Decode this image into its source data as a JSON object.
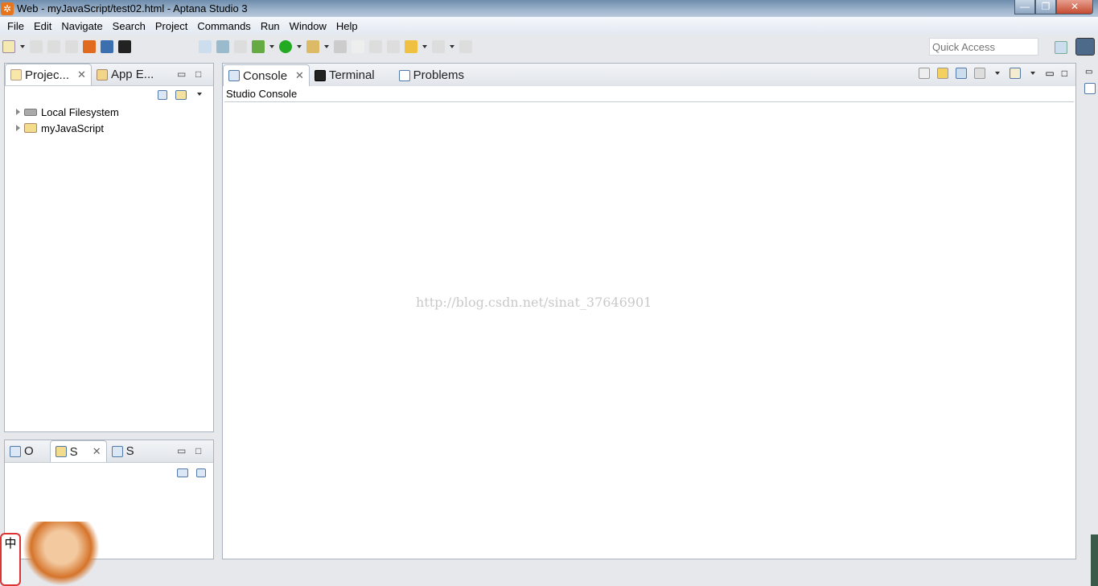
{
  "window": {
    "title": "Web - myJavaScript/test02.html - Aptana Studio 3",
    "minimize": "—",
    "maximize": "❐",
    "close": "✕"
  },
  "menu": [
    "File",
    "Edit",
    "Navigate",
    "Search",
    "Project",
    "Commands",
    "Run",
    "Window",
    "Help"
  ],
  "quick_access": {
    "placeholder": "Quick Access"
  },
  "left_panel": {
    "tabs": [
      {
        "label": "Projec...",
        "icon": "project-explorer-icon"
      },
      {
        "label": "App E...",
        "icon": "app-explorer-icon"
      }
    ],
    "tree": [
      {
        "label": "Local Filesystem",
        "icon": "drive-icon"
      },
      {
        "label": "myJavaScript",
        "icon": "project-folder-icon"
      }
    ]
  },
  "bottom_left_panel": {
    "tabs": [
      {
        "label": "O"
      },
      {
        "label": "S"
      },
      {
        "label": "S"
      }
    ]
  },
  "console_panel": {
    "tabs": [
      {
        "label": "Console"
      },
      {
        "label": "Terminal"
      },
      {
        "label": "Problems"
      }
    ],
    "header": "Studio Console"
  },
  "watermark": "http://blog.csdn.net/sinat_37646901",
  "ime": {
    "label": "中"
  }
}
